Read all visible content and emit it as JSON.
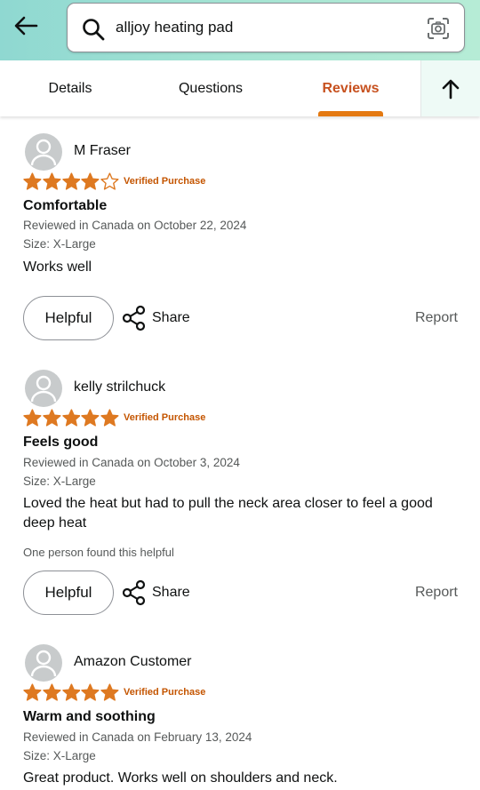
{
  "search": {
    "query": "alljoy heating pad"
  },
  "tabs": [
    {
      "label": "Details"
    },
    {
      "label": "Questions"
    },
    {
      "label": "Reviews"
    }
  ],
  "colors": {
    "accent": "#e47911",
    "star": "#de7921",
    "verified": "#c45500",
    "active_tab": "#c7511f"
  },
  "actions": {
    "helpful": "Helpful",
    "share": "Share",
    "report": "Report"
  },
  "reviews": [
    {
      "name": "M Fraser",
      "rating": 4,
      "verified": "Verified Purchase",
      "title": "Comfortable",
      "reviewed": "Reviewed in Canada on October 22, 2024",
      "size": "Size: X-Large",
      "body": "Works well",
      "helpful_count": ""
    },
    {
      "name": "kelly strilchuck",
      "rating": 5,
      "verified": "Verified Purchase",
      "title": "Feels good",
      "reviewed": "Reviewed in Canada on October 3, 2024",
      "size": "Size: X-Large",
      "body": "Loved the heat but had to pull the neck area closer to feel a good deep heat",
      "helpful_count": "One person found this helpful"
    },
    {
      "name": "Amazon Customer",
      "rating": 5,
      "verified": "Verified Purchase",
      "title": "Warm and soothing",
      "reviewed": "Reviewed in Canada on February 13, 2024",
      "size": "Size: X-Large",
      "body": "Great product. Works well on shoulders and neck.",
      "helpful_count": ""
    }
  ]
}
